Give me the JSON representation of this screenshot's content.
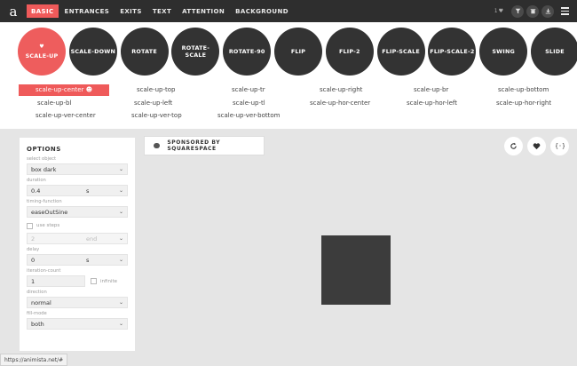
{
  "logo": "a",
  "nav": [
    "BASIC",
    "ENTRANCES",
    "EXITS",
    "TEXT",
    "ATTENTION",
    "BACKGROUND"
  ],
  "top_right": {
    "count": "1",
    "heart_icon": "heart-icon"
  },
  "circles": [
    "SCALE-UP",
    "SCALE-DOWN",
    "ROTATE",
    "ROTATE-SCALE",
    "ROTATE-90",
    "FLIP",
    "FLIP-2",
    "FLIP-SCALE",
    "FLIP-SCALE-2",
    "SWING",
    "SLIDE"
  ],
  "active_circle_heart": "♥",
  "sub_rows": [
    [
      "scale-up-center",
      "scale-up-top",
      "scale-up-tr",
      "scale-up-right",
      "scale-up-br",
      "scale-up-bottom"
    ],
    [
      "scale-up-bl",
      "scale-up-left",
      "scale-up-tl",
      "scale-up-hor-center",
      "scale-up-hor-left",
      "scale-up-hor-right"
    ],
    [
      "scale-up-ver-center",
      "scale-up-ver-top",
      "scale-up-ver-bottom"
    ]
  ],
  "options": {
    "title": "OPTIONS",
    "select_object_label": "select object",
    "select_object_value": "box dark",
    "duration_label": "duration",
    "duration_value": "0.4",
    "duration_unit": "s",
    "timing_label": "timing-function",
    "timing_value": "easeOutSine",
    "use_steps_label": "use steps",
    "steps_value": "2",
    "steps_unit": "end",
    "delay_label": "delay",
    "delay_value": "0",
    "delay_unit": "s",
    "iteration_label": "iteration-count",
    "iteration_value": "1",
    "infinite_label": "infinite",
    "direction_label": "direction",
    "direction_value": "normal",
    "fill_mode_label": "fill-mode",
    "fill_mode_value": "both"
  },
  "sponsor_label": "SPONSORED BY SQUARESPACE",
  "right_buttons": [
    "refresh-icon",
    "heart-icon",
    "code-icon"
  ],
  "status_url": "https://animista.net/#",
  "colors": {
    "accent": "#ef5a5a",
    "dark": "#333333",
    "topbar": "#2e2e2e"
  }
}
